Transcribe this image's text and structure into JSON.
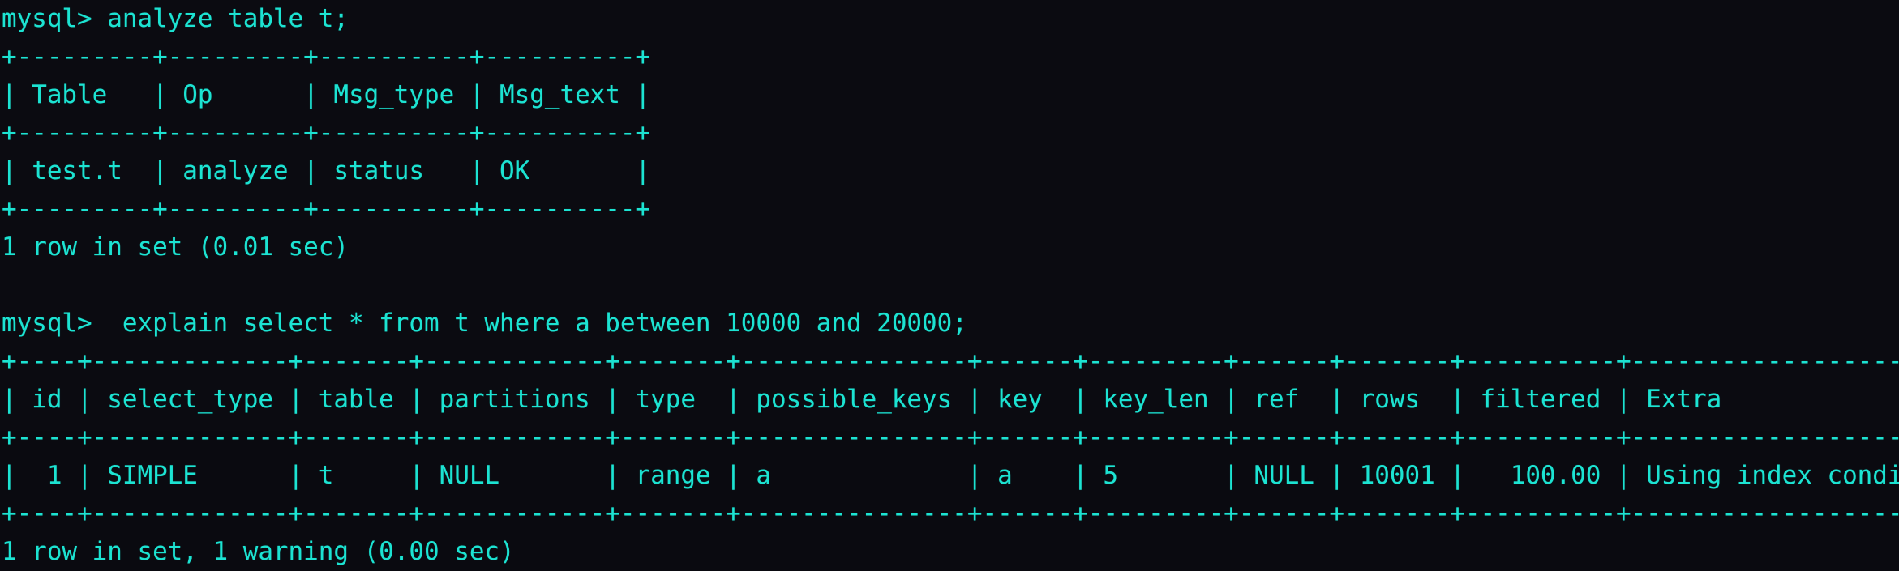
{
  "terminal": {
    "app": "mysql-client",
    "colors": {
      "background": "#0b0b11",
      "foreground": "#1ce3d2"
    },
    "prompt": "mysql>",
    "lines": [
      {
        "kind": "prompt",
        "name": "command-analyze",
        "text": "mysql> analyze table t;"
      },
      {
        "kind": "rule",
        "name": "analyze-table-top-border",
        "text": "+---------+---------+----------+----------+"
      },
      {
        "kind": "header",
        "name": "analyze-table-header-row",
        "text": "| Table   | Op      | Msg_type | Msg_text |"
      },
      {
        "kind": "rule",
        "name": "analyze-table-mid-border",
        "text": "+---------+---------+----------+----------+"
      },
      {
        "kind": "row",
        "name": "analyze-table-data-row",
        "text": "| test.t  | analyze | status   | OK       |"
      },
      {
        "kind": "rule",
        "name": "analyze-table-bottom-border",
        "text": "+---------+---------+----------+----------+"
      },
      {
        "kind": "status",
        "name": "analyze-result-status",
        "text": "1 row in set (0.01 sec)"
      },
      {
        "kind": "blank",
        "name": "blank-line",
        "text": ""
      },
      {
        "kind": "prompt",
        "name": "command-explain",
        "text": "mysql>  explain select * from t where a between 10000 and 20000;"
      },
      {
        "kind": "rule",
        "name": "explain-table-top-border",
        "text": "+----+-------------+-------+------------+-------+---------------+------+---------+------+-------+----------+-----------------------+"
      },
      {
        "kind": "header",
        "name": "explain-table-header-row",
        "text": "| id | select_type | table | partitions | type  | possible_keys | key  | key_len | ref  | rows  | filtered | Extra                 |"
      },
      {
        "kind": "rule",
        "name": "explain-table-mid-border",
        "text": "+----+-------------+-------+------------+-------+---------------+------+---------+------+-------+----------+-----------------------+"
      },
      {
        "kind": "row",
        "name": "explain-table-data-row",
        "text": "|  1 | SIMPLE      | t     | NULL       | range | a             | a    | 5       | NULL | 10001 |   100.00 | Using index condition |"
      },
      {
        "kind": "rule",
        "name": "explain-table-bottom-border",
        "text": "+----+-------------+-------+------------+-------+---------------+------+---------+------+-------+----------+-----------------------+"
      },
      {
        "kind": "status",
        "name": "explain-result-status",
        "text": "1 row in set, 1 warning (0.00 sec)"
      }
    ],
    "analyze_table": {
      "columns": [
        "Table",
        "Op",
        "Msg_type",
        "Msg_text"
      ],
      "rows": [
        [
          "test.t",
          "analyze",
          "status",
          "OK"
        ]
      ],
      "status": "1 row in set (0.01 sec)"
    },
    "explain_table": {
      "columns": [
        "id",
        "select_type",
        "table",
        "partitions",
        "type",
        "possible_keys",
        "key",
        "key_len",
        "ref",
        "rows",
        "filtered",
        "Extra"
      ],
      "rows": [
        [
          "1",
          "SIMPLE",
          "t",
          "NULL",
          "range",
          "a",
          "a",
          "5",
          "NULL",
          "10001",
          "100.00",
          "Using index condition"
        ]
      ],
      "status": "1 row in set, 1 warning (0.00 sec)"
    }
  }
}
